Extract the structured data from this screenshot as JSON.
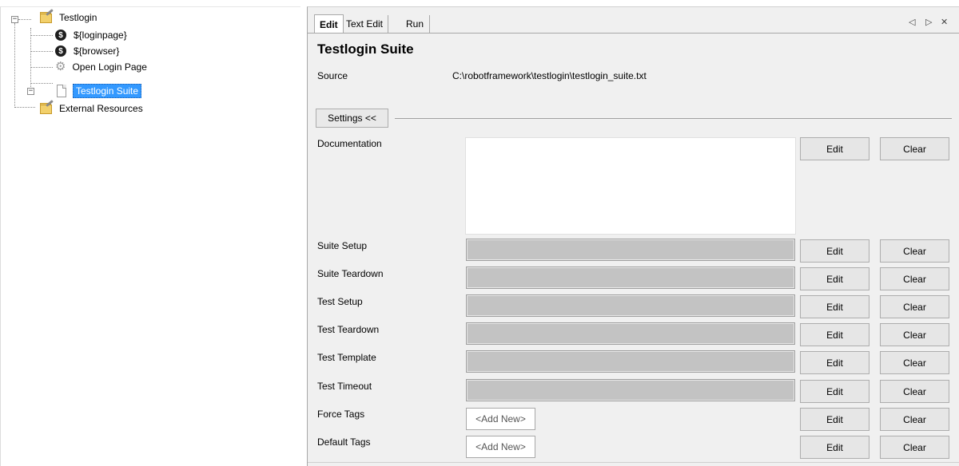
{
  "tree": {
    "root": {
      "label": "Testlogin",
      "icon": "folder-edit-icon"
    },
    "items": [
      {
        "label": "${loginpage}",
        "icon": "variable-icon"
      },
      {
        "label": "${browser}",
        "icon": "variable-icon"
      },
      {
        "label": "Open Login Page",
        "icon": "gear-icon"
      },
      {
        "label": "Testlogin Suite",
        "icon": "file-icon",
        "selected": true
      }
    ],
    "external": {
      "label": "External Resources",
      "icon": "folder-edit-icon"
    }
  },
  "tabs": [
    {
      "label": "Edit",
      "active": true
    },
    {
      "label": "Text Edit"
    },
    {
      "label": "Run"
    }
  ],
  "tab_nav": {
    "prev": "◁",
    "next": "▷",
    "close": "✕"
  },
  "editor": {
    "title": "Testlogin Suite",
    "source_label": "Source",
    "source_value": "C:\\robotframework\\testlogin\\testlogin_suite.txt",
    "settings_toggle": "Settings <<",
    "settings": [
      {
        "label": "Documentation",
        "kind": "doc"
      },
      {
        "label": "Suite Setup",
        "kind": "field"
      },
      {
        "label": "Suite Teardown",
        "kind": "field"
      },
      {
        "label": "Test Setup",
        "kind": "field"
      },
      {
        "label": "Test Teardown",
        "kind": "field"
      },
      {
        "label": "Test Template",
        "kind": "field"
      },
      {
        "label": "Test Timeout",
        "kind": "field"
      },
      {
        "label": "Force Tags",
        "kind": "tags",
        "placeholder": "<Add New>"
      },
      {
        "label": "Default Tags",
        "kind": "tags",
        "placeholder": "<Add New>"
      }
    ],
    "edit_label": "Edit",
    "clear_label": "Clear"
  }
}
